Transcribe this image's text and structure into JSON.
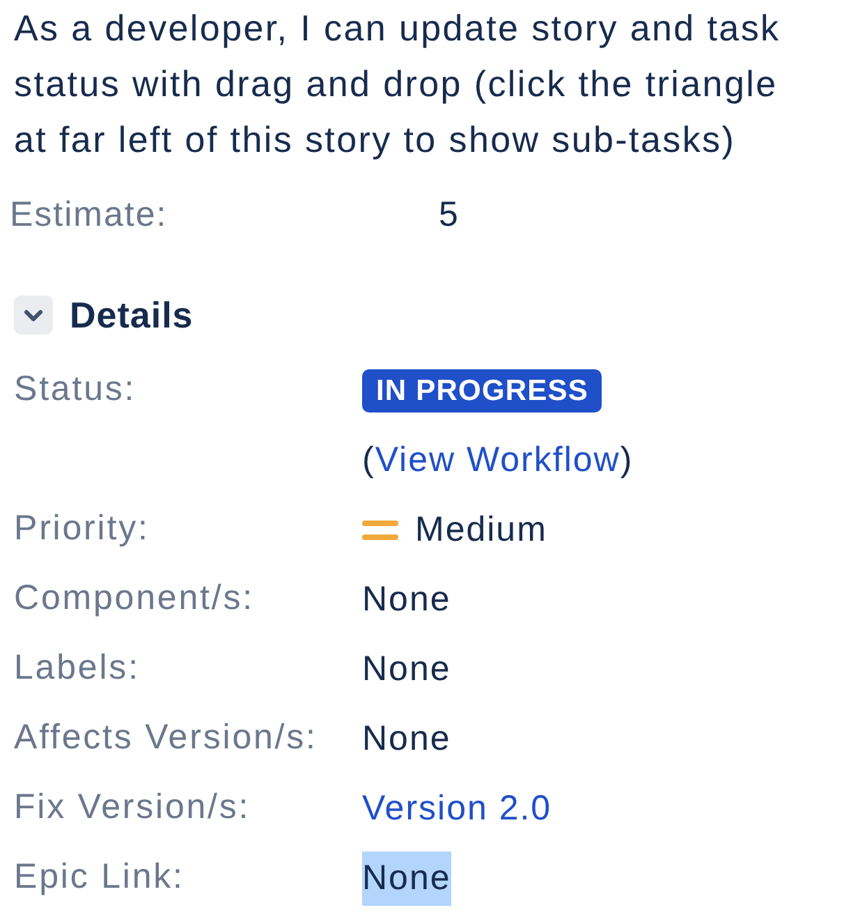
{
  "description": "As a developer, I can update story and task status with drag and drop (click the triangle at far left of this story to show sub-tasks)",
  "estimate": {
    "label": "Estimate:",
    "value": "5"
  },
  "details": {
    "title": "Details",
    "expanded": true,
    "fields": [
      {
        "kind": "status",
        "label": "Status:",
        "value": "IN PROGRESS",
        "workflow": {
          "before": "(",
          "link": "View Workflow",
          "after": ")"
        },
        "highlighted": false
      },
      {
        "kind": "priority",
        "label": "Priority:",
        "value": "Medium",
        "highlighted": false
      },
      {
        "kind": "text",
        "label": "Component/s:",
        "value": "None",
        "highlighted": false
      },
      {
        "kind": "text",
        "label": "Labels:",
        "value": "None",
        "highlighted": false
      },
      {
        "kind": "text",
        "label": "Affects Version/s:",
        "value": "None",
        "highlighted": false
      },
      {
        "kind": "link",
        "label": "Fix Version/s:",
        "value": "Version 2.0",
        "highlighted": false
      },
      {
        "kind": "text",
        "label": "Epic Link:",
        "value": "None",
        "highlighted": true
      }
    ]
  }
}
